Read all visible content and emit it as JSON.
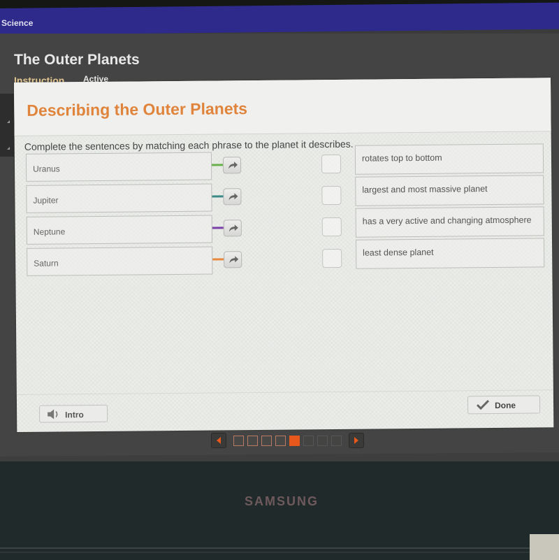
{
  "app": {
    "subject": "Science",
    "lesson_title": "The Outer Planets",
    "tabs": [
      {
        "label": "Instruction",
        "selected": true
      },
      {
        "label": "Active",
        "selected": false
      }
    ]
  },
  "activity": {
    "title": "Describing the Outer Planets",
    "instructions": "Complete the sentences by matching each phrase to the planet it describes.",
    "planets": [
      {
        "label": "Uranus",
        "connector_color": "#6ab04c"
      },
      {
        "label": "Jupiter",
        "connector_color": "#3a8a8a"
      },
      {
        "label": "Neptune",
        "connector_color": "#7a3fa8"
      },
      {
        "label": "Saturn",
        "connector_color": "#e8883c"
      }
    ],
    "phrases": [
      {
        "label": "rotates top to bottom"
      },
      {
        "label": "largest and most massive planet"
      },
      {
        "label": "has a very active and changing atmosphere"
      },
      {
        "label": "least dense planet"
      }
    ]
  },
  "footer": {
    "intro_label": "Intro",
    "done_label": "Done"
  },
  "pager": {
    "total_pages": 8,
    "current_page": 5,
    "visited_pages": [
      1,
      2,
      3,
      4
    ]
  },
  "device": {
    "brand": "SAMSUNG"
  },
  "colors": {
    "accent_orange": "#e0843c",
    "subject_bar": "#2d2a8c",
    "current_page": "#e8571c"
  }
}
